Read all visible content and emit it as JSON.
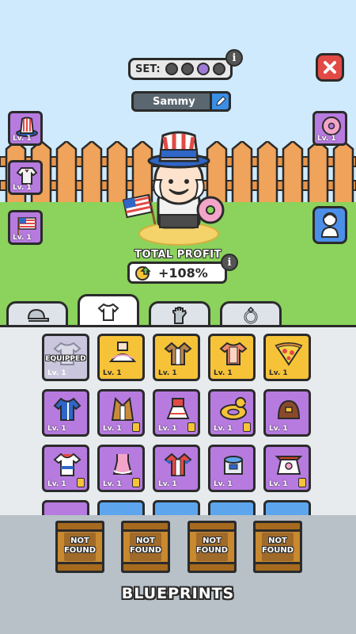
{
  "header": {
    "set_label": "SET:",
    "set_slots": [
      "empty",
      "empty",
      "lit",
      "empty"
    ],
    "info_icon": "i",
    "character_name": "Sammy",
    "close_icon": "close-x-icon",
    "edit_icon": "pencil-icon"
  },
  "left_slots": [
    {
      "label": "Lv. 1",
      "icon": "uncle-sam-hat-icon"
    },
    {
      "label": "Lv. 1",
      "icon": "shirt-icon"
    },
    {
      "label": "Lv. 1",
      "icon": "usa-flag-icon"
    }
  ],
  "right_slots": [
    {
      "label": "Lv. 1",
      "icon": "donut-icon"
    }
  ],
  "profit": {
    "title": "TOTAL PROFIT",
    "value": "+108%"
  },
  "tabs": [
    {
      "icon": "cap-icon",
      "active": false
    },
    {
      "icon": "tshirt-icon",
      "active": true
    },
    {
      "icon": "glove-icon",
      "active": false
    },
    {
      "icon": "ring-icon",
      "active": false
    }
  ],
  "items": [
    [
      {
        "label": "Lv. 1",
        "color": "grey",
        "equipped": "EQUIPPED"
      },
      {
        "label": "Lv. 1",
        "color": "gold"
      },
      {
        "label": "Lv. 1",
        "color": "gold"
      },
      {
        "label": "Lv. 1",
        "color": "gold"
      },
      {
        "label": "Lv. 1",
        "color": "gold"
      }
    ],
    [
      {
        "label": "Lv. 1",
        "color": "purple"
      },
      {
        "label": "Lv. 1",
        "color": "purple"
      },
      {
        "label": "Lv. 1",
        "color": "purple"
      },
      {
        "label": "Lv. 1",
        "color": "purple"
      },
      {
        "label": "Lv. 1",
        "color": "purple"
      }
    ],
    [
      {
        "label": "Lv. 1",
        "color": "purple"
      },
      {
        "label": "Lv. 1",
        "color": "purple"
      },
      {
        "label": "Lv. 1",
        "color": "purple"
      },
      {
        "label": "Lv. 1",
        "color": "purple"
      },
      {
        "label": "Lv. 1",
        "color": "purple"
      }
    ]
  ],
  "blueprints": {
    "slots": [
      "NOT FOUND",
      "NOT FOUND",
      "NOT FOUND",
      "NOT FOUND"
    ],
    "title": "BLUEPRINTS"
  }
}
